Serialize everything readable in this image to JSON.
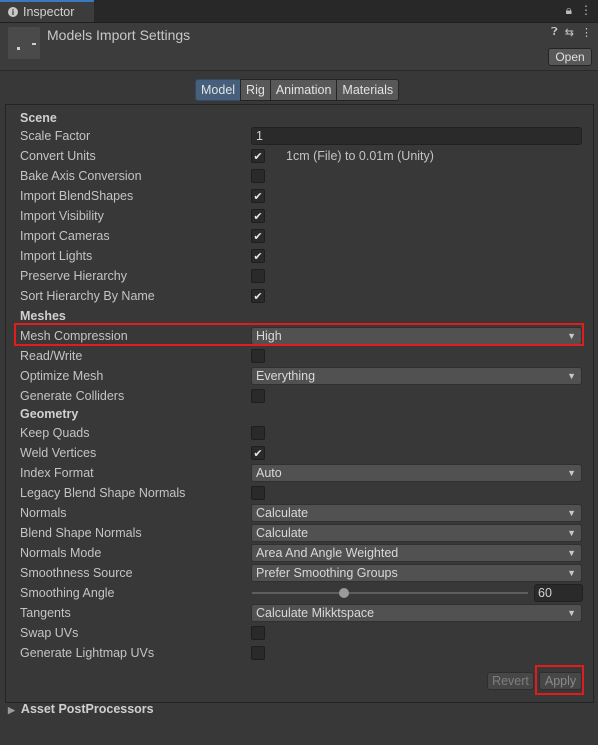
{
  "tab": {
    "label": "Inspector"
  },
  "header": {
    "title": "Models Import Settings",
    "open_label": "Open"
  },
  "toolbar": {
    "tabs": [
      "Model",
      "Rig",
      "Animation",
      "Materials"
    ],
    "active": "Model"
  },
  "scene": {
    "heading": "Scene",
    "scale_factor": {
      "label": "Scale Factor",
      "value": "1"
    },
    "convert_units": {
      "label": "Convert Units",
      "checked": true,
      "note": "1cm (File) to 0.01m (Unity)"
    },
    "bake_axis": {
      "label": "Bake Axis Conversion",
      "checked": false
    },
    "blendshapes": {
      "label": "Import BlendShapes",
      "checked": true
    },
    "visibility": {
      "label": "Import Visibility",
      "checked": true
    },
    "cameras": {
      "label": "Import Cameras",
      "checked": true
    },
    "lights": {
      "label": "Import Lights",
      "checked": true
    },
    "preserve": {
      "label": "Preserve Hierarchy",
      "checked": false
    },
    "sort": {
      "label": "Sort Hierarchy By Name",
      "checked": true
    }
  },
  "meshes": {
    "heading": "Meshes",
    "compression": {
      "label": "Mesh Compression",
      "value": "High"
    },
    "readwrite": {
      "label": "Read/Write",
      "checked": false
    },
    "optimize": {
      "label": "Optimize Mesh",
      "value": "Everything"
    },
    "colliders": {
      "label": "Generate Colliders",
      "checked": false
    }
  },
  "geometry": {
    "heading": "Geometry",
    "keep_quads": {
      "label": "Keep Quads",
      "checked": false
    },
    "weld": {
      "label": "Weld Vertices",
      "checked": true
    },
    "index_format": {
      "label": "Index Format",
      "value": "Auto"
    },
    "legacy": {
      "label": "Legacy Blend Shape Normals",
      "checked": false
    },
    "normals": {
      "label": "Normals",
      "value": "Calculate"
    },
    "blend_normals": {
      "label": "Blend Shape Normals",
      "value": "Calculate"
    },
    "normals_mode": {
      "label": "Normals Mode",
      "value": "Area And Angle Weighted"
    },
    "smooth_source": {
      "label": "Smoothness Source",
      "value": "Prefer Smoothing Groups"
    },
    "smooth_angle": {
      "label": "Smoothing Angle",
      "value": "60",
      "min": 0,
      "max": 180
    },
    "tangents": {
      "label": "Tangents",
      "value": "Calculate Mikktspace"
    },
    "swap_uvs": {
      "label": "Swap UVs",
      "checked": false
    },
    "lightmap_uvs": {
      "label": "Generate Lightmap UVs",
      "checked": false
    }
  },
  "actions": {
    "revert": "Revert",
    "apply": "Apply"
  },
  "footer": {
    "label": "Asset PostProcessors"
  },
  "icons": {
    "check": "check-icon",
    "caret": "caret-down-icon"
  }
}
